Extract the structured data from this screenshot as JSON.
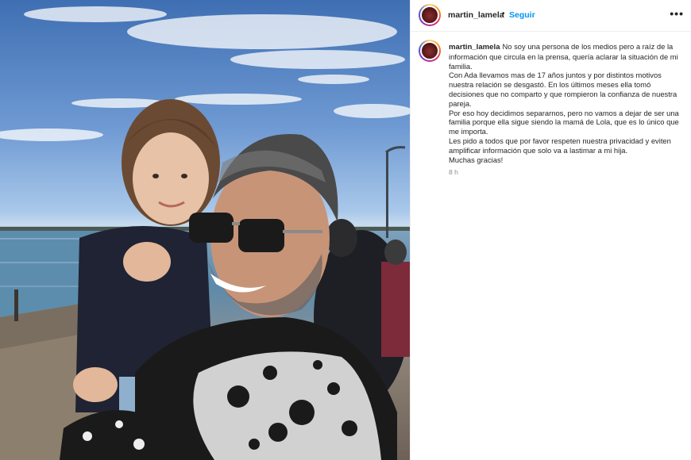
{
  "post": {
    "username": "martin_lamela",
    "separator": "•",
    "follow_label": "Seguir",
    "more_label": "•••",
    "caption_lines": [
      "No soy una persona de los medios pero a raíz de la información que circula en la prensa, quería aclarar la situación de mi familia.",
      "Con Ada llevamos mas de 17 años juntos y por distintos motivos nuestra relación se desgastó. En los últimos meses ella tomó decisiones que no comparto y que rompieron la confianza de nuestra pareja.",
      "Por eso hoy decidimos separarnos, pero no vamos a dejar de ser una familia porque ella sigue siendo la mamá de Lola, que es lo único que me importa.",
      "Les pido a todos que por favor respeten nuestra privacidad y eviten amplificar información que solo va a lastimar a mi hija.",
      "Muchas gracias!"
    ],
    "timestamp": "8 h"
  },
  "photo": {
    "description_icon": "post-photo"
  },
  "colors": {
    "link_blue": "#0095f6",
    "secondary_text": "#8e8e8e",
    "border": "#efefef"
  }
}
